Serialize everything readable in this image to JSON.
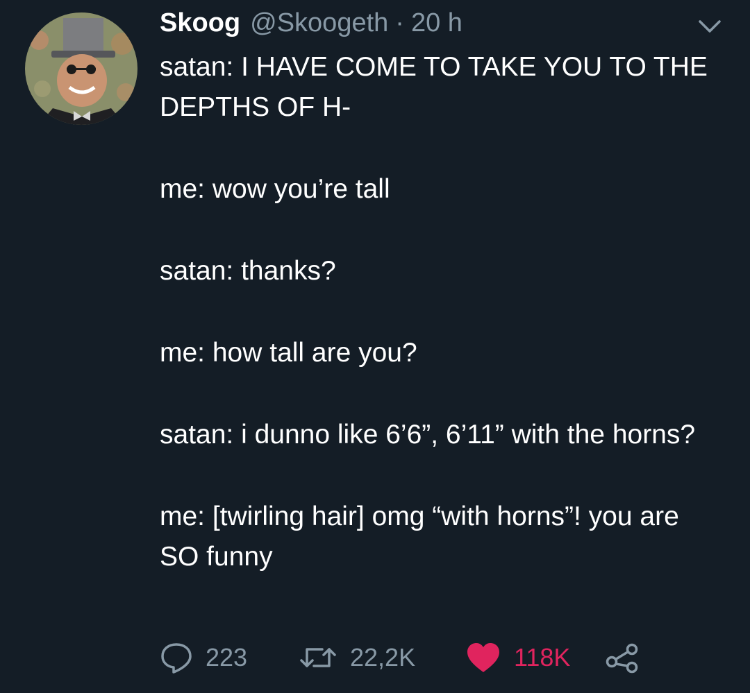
{
  "tweet": {
    "author": {
      "name": "Skoog",
      "handle": "@Skoogeth",
      "separator": "·",
      "time": "20 h"
    },
    "paragraphs": [
      "satan: I HAVE COME TO TAKE YOU TO THE DEPTHS OF H-",
      "me: wow you’re tall",
      "satan: thanks?",
      "me: how tall are you?",
      "satan: i dunno like 6’6”, 6’11” with the horns?",
      "me: [twirling hair] omg “with horns”! you are SO funny"
    ],
    "actions": {
      "replies": "223",
      "retweets": "22,2K",
      "likes": "118K"
    }
  },
  "icons": {
    "reply": "speech-bubble-icon",
    "retweet": "retweet-arrows-icon",
    "like": "heart-icon",
    "share": "share-nodes-icon",
    "menu": "chevron-down-icon"
  },
  "colors": {
    "background": "#141d26",
    "text": "#ffffff",
    "muted": "#8899a6",
    "like": "#e0245e"
  }
}
